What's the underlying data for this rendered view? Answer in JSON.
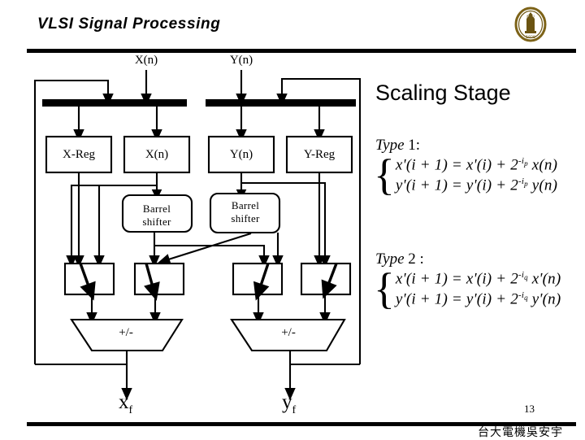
{
  "header": {
    "title": "VLSI Signal Processing",
    "logo_name": "university-seal"
  },
  "right_panel": {
    "stage_title": "Scaling Stage",
    "type1": {
      "label": "Type",
      "number": "1:",
      "eq_x": "x'(i + 1) = x'(i) + 2",
      "eq_x_exp": "-i",
      "eq_x_exp_sub": "p",
      "eq_x_tail": "x(n)",
      "eq_y": "y'(i + 1) = y'(i) + 2",
      "eq_y_exp": "-i",
      "eq_y_exp_sub": "p",
      "eq_y_tail": "y(n)"
    },
    "type2": {
      "label": "Type",
      "number": "2 :",
      "eq_x": "x'(i + 1) = x'(i) + 2",
      "eq_x_exp": "-i",
      "eq_x_exp_sub": "q",
      "eq_x_tail": "x'(n)",
      "eq_y": "y'(i + 1) = y'(i) + 2",
      "eq_y_exp": "-i",
      "eq_y_exp_sub": "q",
      "eq_y_tail": "y'(n)"
    }
  },
  "diagram": {
    "input_x_label": "X(n)",
    "input_y_label": "Y(n)",
    "registers": [
      {
        "label": "X-Reg"
      },
      {
        "label": "X(n)"
      },
      {
        "label": "Y(n)"
      },
      {
        "label": "Y-Reg"
      }
    ],
    "barrel_shifters": [
      {
        "line1": "Barrel",
        "line2": "shifter"
      },
      {
        "line1": "Barrel",
        "line2": "shifter"
      }
    ],
    "muxes": [
      {
        "name": "mux-1"
      },
      {
        "name": "mux-2"
      },
      {
        "name": "mux-3"
      },
      {
        "name": "mux-4"
      }
    ],
    "alus": [
      {
        "label": "+/-"
      },
      {
        "label": "+/-"
      }
    ],
    "outputs": [
      {
        "base": "x",
        "sub": "f"
      },
      {
        "base": "y",
        "sub": "f"
      }
    ]
  },
  "footer": {
    "page_number": "13",
    "credit": "台大電機吳安宇"
  },
  "colors": {
    "ink": "#000000",
    "logo_gold": "#8a6f1e",
    "background": "#ffffff"
  }
}
